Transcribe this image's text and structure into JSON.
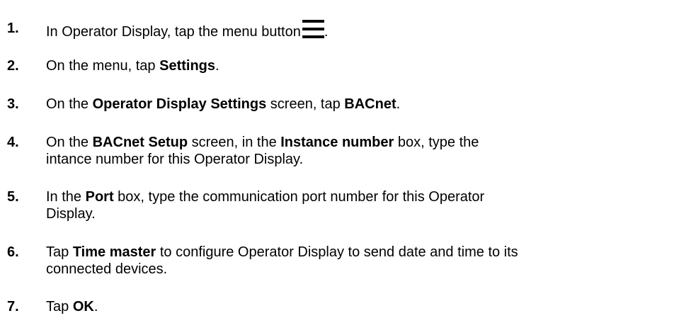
{
  "steps": [
    {
      "number": "1.",
      "before": "In Operator Display, tap the menu button",
      "icon": "menu-hamburger-icon",
      "after": "."
    },
    {
      "number": "2.",
      "t1": "On the menu, tap ",
      "b1": "Settings",
      "t2": "."
    },
    {
      "number": "3.",
      "t1": "On the ",
      "b1": "Operator Display Settings",
      "t2": " screen, tap ",
      "b2": "BACnet",
      "t3": "."
    },
    {
      "number": "4.",
      "t1": "On the ",
      "b1": "BACnet Setup",
      "t2": " screen, in the ",
      "b2": "Instance number",
      "t3": " box, type the",
      "line2": "intance number for this Operator Display."
    },
    {
      "number": "5.",
      "t1": "In the ",
      "b1": "Port",
      "t2": " box, type the communication port number for this Operator",
      "line2": "Display."
    },
    {
      "number": "6.",
      "t1": "Tap ",
      "b1": "Time master",
      "t2": " to configure Operator Display to send date and time to its",
      "line2": "connected devices."
    },
    {
      "number": "7.",
      "t1": "Tap ",
      "b1": "OK",
      "t2": "."
    }
  ]
}
